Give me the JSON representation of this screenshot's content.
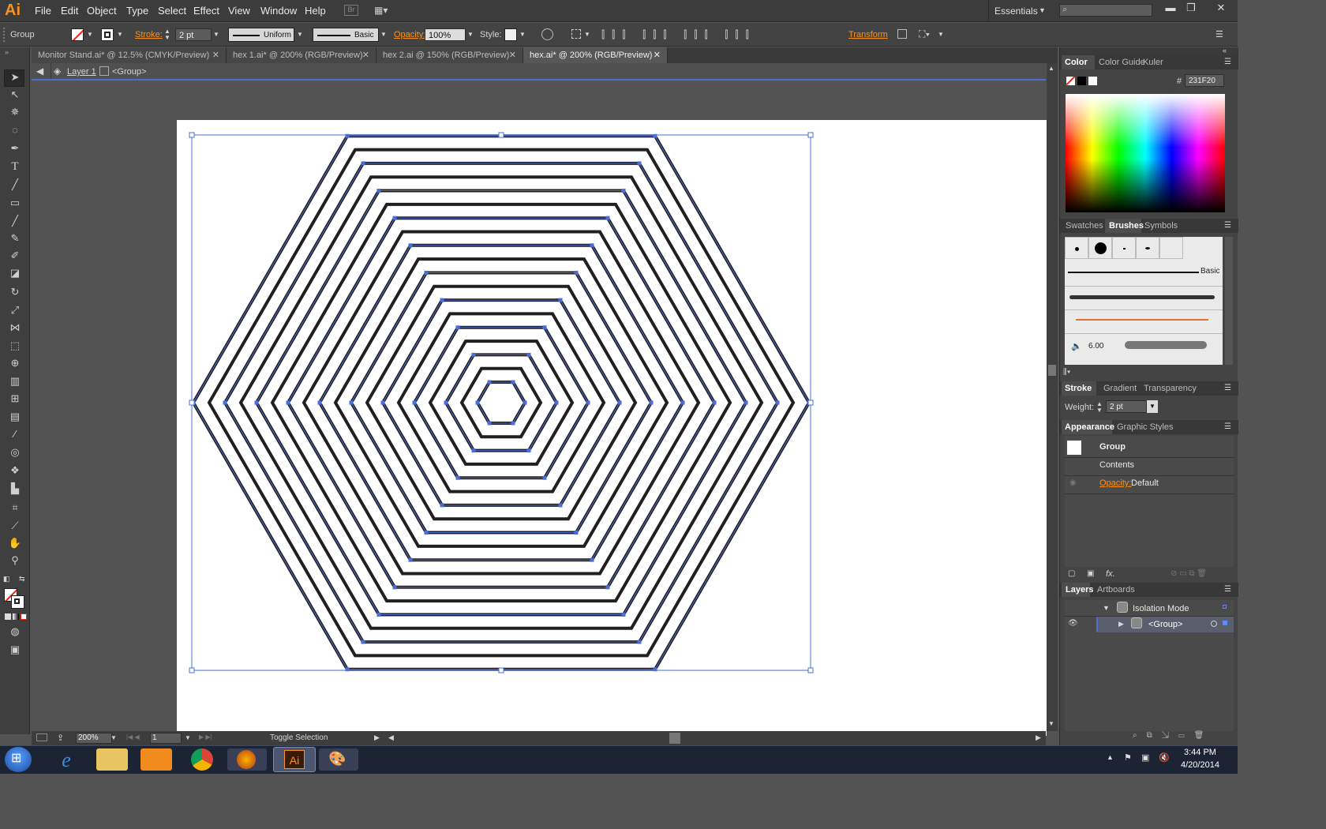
{
  "app": {
    "logo": "Ai"
  },
  "menu": [
    "File",
    "Edit",
    "Object",
    "Type",
    "Select",
    "Effect",
    "View",
    "Window",
    "Help"
  ],
  "menu_br": "Br",
  "workspace": "Essentials",
  "control": {
    "selection": "Group",
    "stroke_label": "Stroke:",
    "stroke_weight": "2 pt",
    "profile": "Uniform",
    "brush": "Basic",
    "opacity_label": "Opacity:",
    "opacity": "100%",
    "style_label": "Style:",
    "transform": "Transform"
  },
  "tabs": [
    "Monitor Stand.ai* @ 12.5% (CMYK/Preview)",
    "hex 1.ai* @ 200% (RGB/Preview)",
    "hex 2.ai @ 150% (RGB/Preview)",
    "hex.ai* @ 200% (RGB/Preview)"
  ],
  "breadcrumb": {
    "layer": "Layer 1",
    "group": "<Group>"
  },
  "status": {
    "zoom": "200%",
    "artboard": "1",
    "toggle": "Toggle Selection"
  },
  "color_panel": {
    "tabs": [
      "Color",
      "Color Guide",
      "Kuler"
    ],
    "hex_label": "#",
    "hex": "231F20"
  },
  "brushes_panel": {
    "tabs": [
      "Swatches",
      "Brushes",
      "Symbols"
    ],
    "basic": "Basic",
    "size": "6.00"
  },
  "stroke_panel": {
    "tabs": [
      "Stroke",
      "Gradient",
      "Transparency"
    ],
    "weight_label": "Weight:",
    "weight": "2 pt"
  },
  "appearance_panel": {
    "tabs": [
      "Appearance",
      "Graphic Styles"
    ],
    "group": "Group",
    "contents": "Contents",
    "opacity_label": "Opacity:",
    "opacity_value": "Default"
  },
  "layers_panel": {
    "tabs": [
      "Layers",
      "Artboards"
    ],
    "isolation": "Isolation Mode",
    "group": "<Group>"
  },
  "taskbar": {
    "time": "3:44 PM",
    "date": "4/20/2014"
  },
  "colors": {
    "accent": "#f7931e",
    "selection": "#4a6fd4",
    "stroke": "#231F20"
  }
}
